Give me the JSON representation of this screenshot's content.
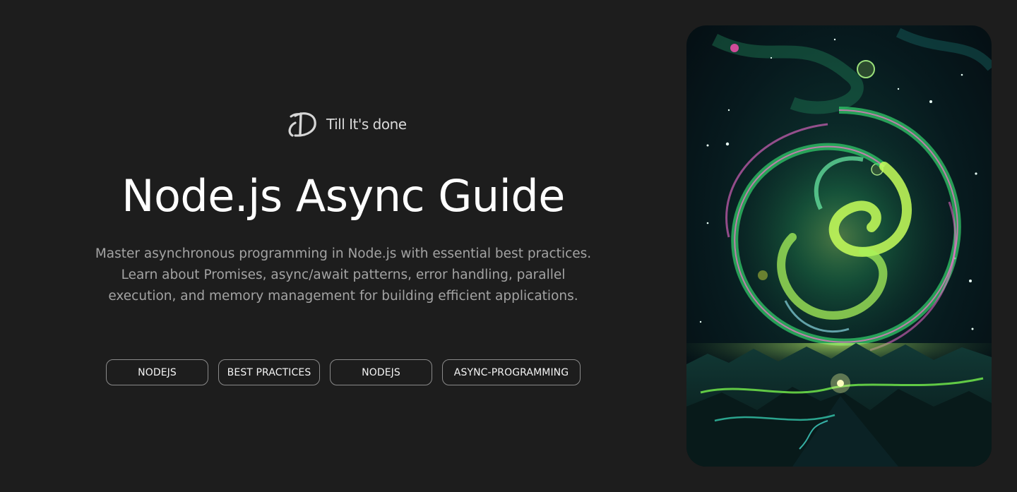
{
  "brand": {
    "name": "Till It's done",
    "logo_icon": "td-monogram-icon"
  },
  "hero": {
    "title": "Node.js Async Guide",
    "description_lines": [
      "Master asynchronous programming in Node.js with essential best practices.",
      "Learn about Promises, async/await patterns, error handling, parallel",
      "execution, and memory management for building efficient applications."
    ],
    "tags": [
      "NODEJS",
      "BEST PRACTICES",
      "NODEJS",
      "ASYNC-PROGRAMMING"
    ]
  },
  "cover_image": {
    "subject": "cosmic-spiral-artwork"
  },
  "colors": {
    "background": "#1d1d1d",
    "title": "#ffffff",
    "description": "#a3a3a3",
    "tag_border": "#8a8a8a",
    "accent_green": "#39e66a"
  }
}
